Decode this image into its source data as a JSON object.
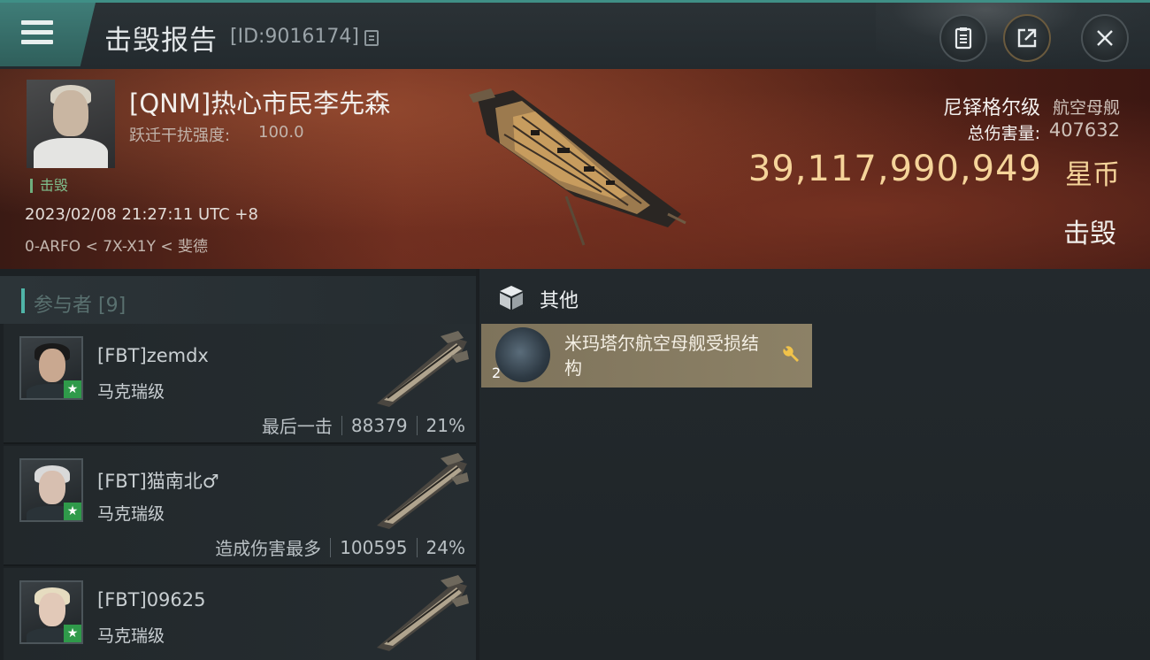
{
  "header": {
    "title": "击毁报告",
    "report_id": "[ID:9016174]"
  },
  "victim": {
    "name": "[QNM]热心市民李先森",
    "warp_label": "跃迁干扰强度:",
    "warp_value": "100.0",
    "status": "击毁",
    "datetime": "2023/02/08 21:27:11 UTC +8",
    "location": "0-ARFO < 7X-X1Y < 斐德",
    "ship_class": "尼铎格尔级",
    "ship_type": "航空母舰",
    "damage_label": "总伤害量:",
    "damage_value": "407632",
    "isk_value": "39,117,990,949",
    "isk_unit": "星币",
    "result": "击毁"
  },
  "participants": {
    "header": "参与者 [9]",
    "rows": [
      {
        "name": "[FBT]zemdx",
        "ship": "马克瑞级",
        "tag": "最后一击",
        "damage": "88379",
        "percent": "21%",
        "hair_color": "#1a1a1a",
        "face_color": "#c9a890"
      },
      {
        "name": "[FBT]猫南北♂",
        "ship": "马克瑞级",
        "tag": "造成伤害最多",
        "damage": "100595",
        "percent": "24%",
        "hair_color": "#d9d9d9",
        "face_color": "#d7bfb0"
      },
      {
        "name": "[FBT]09625",
        "ship": "马克瑞级",
        "tag": "",
        "damage": "",
        "percent": "",
        "hair_color": "#e6dcc0",
        "face_color": "#e2c9b8"
      }
    ]
  },
  "other": {
    "header": "其他",
    "items": [
      {
        "name": "米玛塔尔航空母舰受损结构",
        "qty": "2"
      }
    ]
  },
  "icons": {
    "menu": "hamburger-icon",
    "copy": "copy-icon",
    "clipboard": "clipboard-icon",
    "share": "share-icon",
    "close": "close-icon",
    "cube": "cube-icon",
    "wrench": "wrench-icon",
    "star": "star-icon"
  },
  "colors": {
    "accent_teal": "#3f7d78",
    "isk_gold": "#f5d49a",
    "item_card": "#857a60",
    "star_green": "#2f9a4a"
  }
}
